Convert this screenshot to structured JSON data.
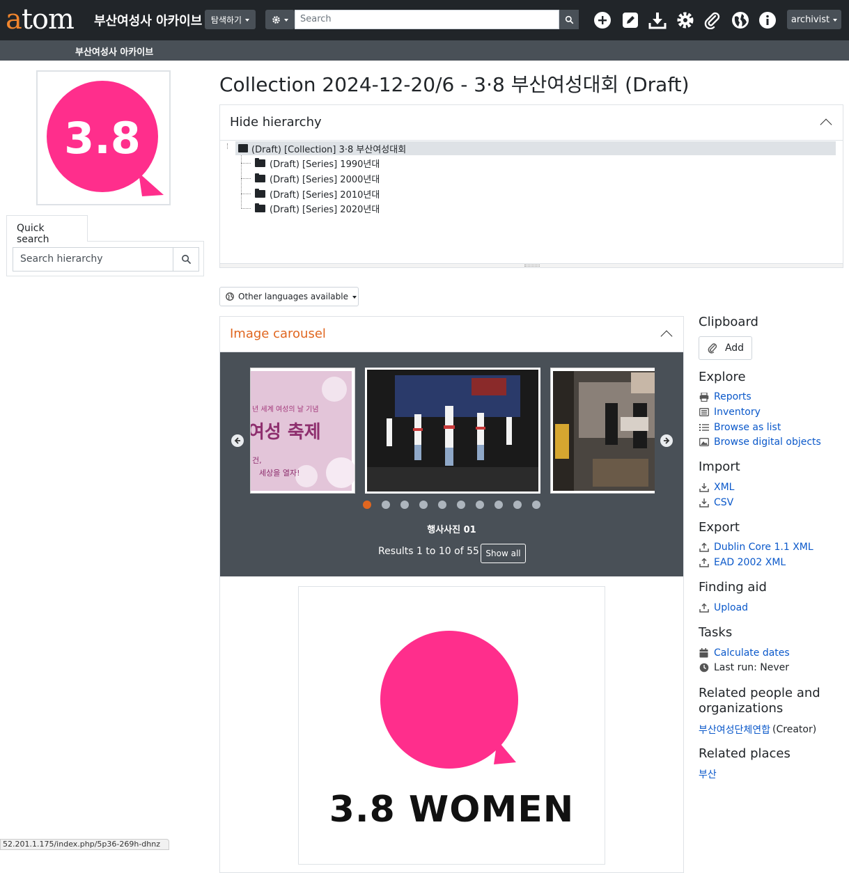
{
  "topnav": {
    "logo_a": "a",
    "logo_rest": "tom",
    "site_name": "부산여성사 아카이브",
    "browse_label": "탐색하기",
    "search_placeholder": "Search",
    "user_label": "archivist",
    "icons": [
      "plus-icon",
      "edit-icon",
      "download-icon",
      "gear-icon",
      "paperclip-icon",
      "globe-icon",
      "info-icon"
    ]
  },
  "subbar": {
    "title": "부산여성사 아카이브"
  },
  "left": {
    "logo_text": "3.8",
    "quick_search_tab": "Quick search",
    "search_placeholder": "Search hierarchy"
  },
  "main": {
    "title": "Collection 2024-12-20/6 - 3·8 부산여성대회 (Draft)",
    "hierarchy": {
      "toggle_label": "Hide hierarchy",
      "root": "(Draft) [Collection] 3·8 부산여성대회",
      "children": [
        "(Draft) [Series] 1990년대",
        "(Draft) [Series] 2000년대",
        "(Draft) [Series] 2010년대",
        "(Draft) [Series] 2020년대"
      ]
    },
    "languages_label": "Other languages available",
    "carousel": {
      "heading": "Image carousel",
      "img1_line1": "년 세계 여성의 날 기념",
      "img1_line2": "여성 축제",
      "img1_line3": "건,",
      "img1_line4": "세상을 열자!",
      "caption": "행사사진 01",
      "results": "Results 1 to 10 of 55",
      "show_all": "Show all",
      "dot_count": 10,
      "active_dot": 0
    },
    "digital_object_text": "3.8 WOMEN"
  },
  "sidebar": {
    "clipboard": {
      "heading": "Clipboard",
      "add": "Add"
    },
    "explore": {
      "heading": "Explore",
      "reports": "Reports",
      "inventory": "Inventory",
      "browse_list": "Browse as list",
      "browse_digital": "Browse digital objects"
    },
    "import": {
      "heading": "Import",
      "xml": "XML",
      "csv": "CSV"
    },
    "export": {
      "heading": "Export",
      "dc": "Dublin Core 1.1 XML",
      "ead": "EAD 2002 XML"
    },
    "finding_aid": {
      "heading": "Finding aid",
      "upload": "Upload"
    },
    "tasks": {
      "heading": "Tasks",
      "calc": "Calculate dates",
      "last_run": "Last run: Never"
    },
    "related_people": {
      "heading_1": "Related people and",
      "heading_2": "organizations",
      "name": "부산여성단체연합",
      "role": "(Creator)"
    },
    "related_places": {
      "heading": "Related places",
      "place": "부산"
    }
  },
  "status_url": "52.201.1.175/index.php/5p36-269h-dhnz",
  "colors": {
    "nav": "#212529",
    "subbar": "#495057",
    "accent_orange": "#e0661f",
    "brand_pink": "#ff2e8c",
    "link": "#0a58ca"
  }
}
